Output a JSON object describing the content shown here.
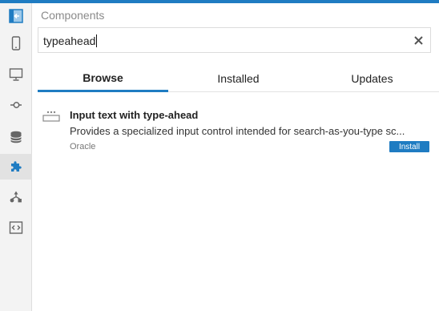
{
  "panel": {
    "title": "Components"
  },
  "search": {
    "value": "typeahead",
    "clear_icon": "close-icon"
  },
  "tabs": [
    {
      "label": "Browse",
      "active": true
    },
    {
      "label": "Installed",
      "active": false
    },
    {
      "label": "Updates",
      "active": false
    }
  ],
  "results": [
    {
      "name": "Input text with type-ahead",
      "description": "Provides a specialized input control intended for search-as-you-type sc...",
      "vendor": "Oracle",
      "action_label": "Install",
      "icon": "input-text-icon"
    }
  ],
  "sidebar": {
    "items": [
      {
        "icon": "collapse-panel-icon",
        "active": false
      },
      {
        "icon": "mobile-device-icon",
        "active": false
      },
      {
        "icon": "desktop-monitor-icon",
        "active": false
      },
      {
        "icon": "git-commit-icon",
        "active": false
      },
      {
        "icon": "database-icon",
        "active": false
      },
      {
        "icon": "puzzle-piece-icon",
        "active": true
      },
      {
        "icon": "hierarchy-icon",
        "active": false
      },
      {
        "icon": "code-tag-icon",
        "active": false
      }
    ]
  },
  "colors": {
    "accent": "#1f7cc2",
    "rail_background": "#f3f3f3"
  }
}
